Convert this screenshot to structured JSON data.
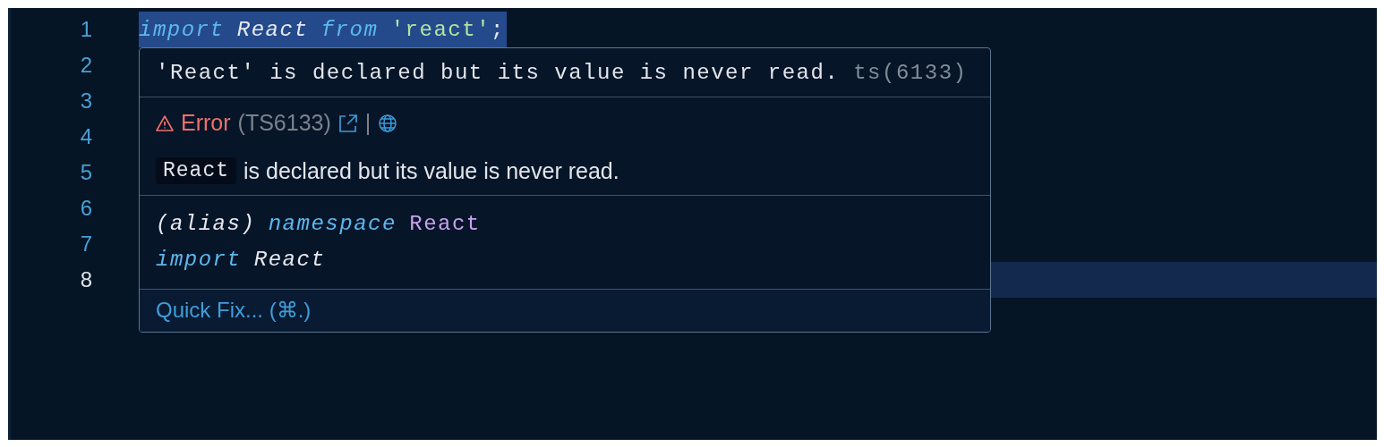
{
  "editor": {
    "lines": [
      {
        "number": "1",
        "current": false,
        "selected": true,
        "tokens": [
          {
            "kind": "keyword",
            "text": "import"
          },
          {
            "kind": "identifier",
            "text": "React"
          },
          {
            "kind": "keyword",
            "text": "from"
          },
          {
            "kind": "string",
            "text": "'react'",
            "after": ";"
          }
        ]
      },
      {
        "number": "2",
        "current": false
      },
      {
        "number": "3",
        "current": false
      },
      {
        "number": "4",
        "current": false
      },
      {
        "number": "5",
        "current": false
      },
      {
        "number": "6",
        "current": false
      },
      {
        "number": "7",
        "current": false
      },
      {
        "number": "8",
        "current": true
      }
    ]
  },
  "hover": {
    "message": "'React' is declared but its value is never read.",
    "message_code": "ts(6133)",
    "severity": "Error",
    "error_code": "(TS6133)",
    "separator": "|",
    "description_code": "React",
    "description": "is declared but its value is never read.",
    "signature": [
      [
        {
          "kind": "plain",
          "text": "(alias)"
        },
        {
          "kind": "keyword",
          "text": "namespace"
        },
        {
          "kind": "type",
          "text": "React"
        }
      ],
      [
        {
          "kind": "keyword",
          "text": "import"
        },
        {
          "kind": "identifier",
          "text": "React"
        }
      ]
    ],
    "quick_fix": "Quick Fix... (⌘.)"
  }
}
